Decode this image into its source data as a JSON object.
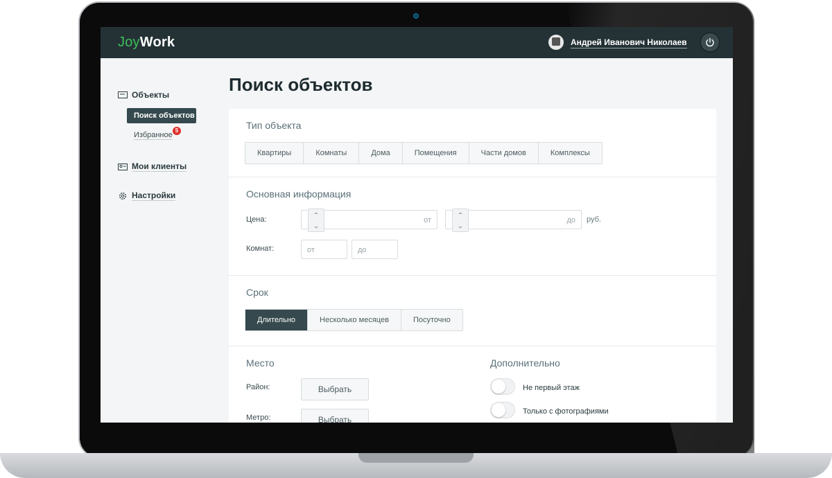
{
  "header": {
    "logo_part1": "Joy",
    "logo_part2": "Work",
    "user_name": "Андрей Иванович Николаев"
  },
  "sidebar": {
    "objects_label": "Объекты",
    "search_label": "Поиск объектов",
    "favorites_label": "Избранное",
    "favorites_badge": "5",
    "clients_label": "Мои клиенты",
    "settings_label": "Настройки"
  },
  "page": {
    "title": "Поиск объектов"
  },
  "object_type": {
    "title": "Тип объекта",
    "options": [
      "Квартиры",
      "Комнаты",
      "Дома",
      "Помещения",
      "Части домов",
      "Комплексы"
    ]
  },
  "basic_info": {
    "title": "Основная информация",
    "price_label": "Цена:",
    "price_from_placeholder": "от",
    "price_to_placeholder": "до",
    "currency": "руб.",
    "rooms_label": "Комнат:",
    "rooms_from_placeholder": "от",
    "rooms_to_placeholder": "до"
  },
  "term": {
    "title": "Срок",
    "options": [
      "Длительно",
      "Несколько месяцев",
      "Посуточно"
    ],
    "selected": "Длительно"
  },
  "place": {
    "title": "Место",
    "district_label": "Район:",
    "metro_label": "Метро:",
    "choose_label": "Выбрать"
  },
  "extra": {
    "title": "Дополнительно",
    "not_first_floor": "Не первый этаж",
    "with_photos": "Только с фотографиями"
  },
  "colors": {
    "topbar": "#243236",
    "accent_green": "#3fbf5a",
    "active_dark": "#35494e",
    "badge_red": "#e0312e"
  }
}
